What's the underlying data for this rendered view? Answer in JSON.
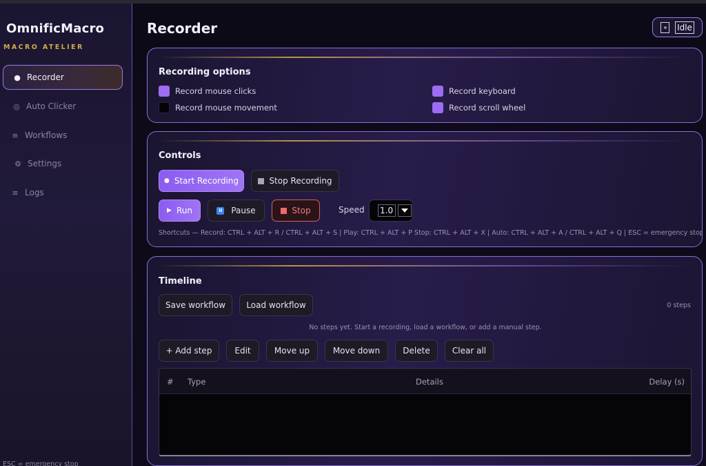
{
  "app": {
    "name": "OmnificMacro",
    "subtitle": "MACRO ATELIER"
  },
  "sidebar": {
    "items": [
      {
        "label": "Recorder",
        "icon": "dot-icon",
        "glyph": "●",
        "active": true
      },
      {
        "label": "Auto Clicker",
        "icon": "target-icon",
        "glyph": "◎"
      },
      {
        "label": "Workflows",
        "icon": "list-icon",
        "glyph": "≡"
      },
      {
        "label": "Settings",
        "icon": "gear-icon",
        "glyph": "⚙"
      },
      {
        "label": "Logs",
        "icon": "list-icon",
        "glyph": "≡"
      }
    ],
    "footer": "ESC = emergency stop"
  },
  "header": {
    "title": "Recorder",
    "status": "Idle"
  },
  "recording_options": {
    "title": "Recording options",
    "options": [
      {
        "label": "Record mouse clicks",
        "checked": true
      },
      {
        "label": "Record keyboard",
        "checked": true
      },
      {
        "label": "Record mouse movement",
        "checked": false
      },
      {
        "label": "Record scroll wheel",
        "checked": true
      }
    ]
  },
  "controls": {
    "title": "Controls",
    "start_recording": "Start Recording",
    "stop_recording": "Stop Recording",
    "run": "Run",
    "pause": "Pause",
    "stop": "Stop",
    "speed_label": "Speed",
    "speed_value": "1.0",
    "shortcuts": "Shortcuts — Record: CTRL + ALT + R / CTRL + ALT + S  |  Play: CTRL + ALT + P  Stop: CTRL + ALT + X  |  Auto: CTRL + ALT + A / CTRL + ALT + Q  |  ESC = emergency stop"
  },
  "timeline": {
    "title": "Timeline",
    "save_workflow": "Save workflow",
    "load_workflow": "Load workflow",
    "steps_count": "0 steps",
    "empty_message": "No steps yet. Start a recording, load a workflow, or add a manual step.",
    "actions": {
      "add_step": "+ Add step",
      "edit": "Edit",
      "move_up": "Move up",
      "move_down": "Move down",
      "delete": "Delete",
      "clear_all": "Clear all"
    },
    "columns": {
      "index": "#",
      "type": "Type",
      "details": "Details",
      "delay": "Delay (s)"
    },
    "rows": []
  },
  "colors": {
    "accent": "#9e6cf2",
    "gold": "#d4a94a",
    "danger": "#ef6a6a",
    "pause": "#3b82f6"
  }
}
